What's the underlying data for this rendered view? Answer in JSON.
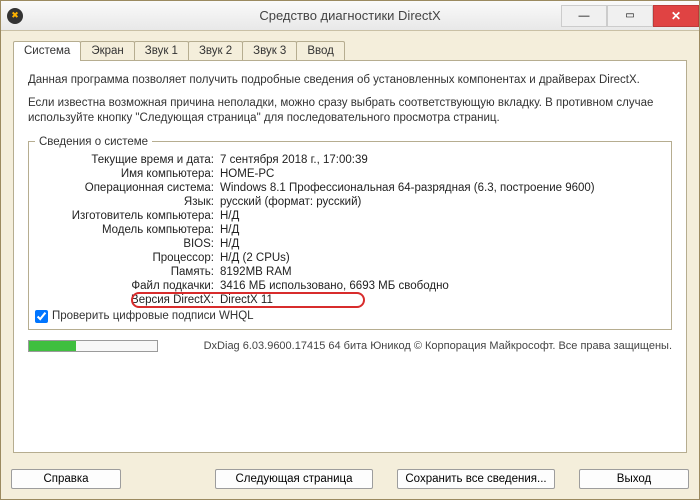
{
  "window": {
    "title": "Средство диагностики DirectX"
  },
  "tabs": [
    "Система",
    "Экран",
    "Звук 1",
    "Звук 2",
    "Звук 3",
    "Ввод"
  ],
  "intro1": "Данная программа позволяет получить подробные сведения об установленных компонентах и драйверах DirectX.",
  "intro2": "Если известна возможная причина неполадки, можно сразу выбрать соответствующую вкладку. В противном случае используйте кнопку \"Следующая страница\" для последовательного просмотра страниц.",
  "group_title": "Сведения о системе",
  "rows": [
    {
      "label": "Текущие время и дата:",
      "value": "7 сентября 2018 г., 17:00:39"
    },
    {
      "label": "Имя компьютера:",
      "value": "HOME-PC"
    },
    {
      "label": "Операционная система:",
      "value": "Windows 8.1 Профессиональная 64-разрядная (6.3, построение 9600)"
    },
    {
      "label": "Язык:",
      "value": "русский (формат: русский)"
    },
    {
      "label": "Изготовитель компьютера:",
      "value": "Н/Д"
    },
    {
      "label": "Модель компьютера:",
      "value": "Н/Д"
    },
    {
      "label": "BIOS:",
      "value": "Н/Д"
    },
    {
      "label": "Процессор:",
      "value": "Н/Д (2 CPUs)"
    },
    {
      "label": "Память:",
      "value": "8192MB RAM"
    },
    {
      "label": "Файл подкачки:",
      "value": "3416 МБ использовано, 6693 МБ свободно"
    },
    {
      "label": "Версия DirectX:",
      "value": "DirectX 11"
    }
  ],
  "highlight_index": 10,
  "whql": "Проверить цифровые подписи WHQL",
  "footer_info": "DxDiag 6.03.9600.17415 64 бита Юникод © Корпорация Майкрософт. Все права защищены.",
  "buttons": {
    "help": "Справка",
    "next": "Следующая страница",
    "save": "Сохранить все сведения...",
    "exit": "Выход"
  }
}
